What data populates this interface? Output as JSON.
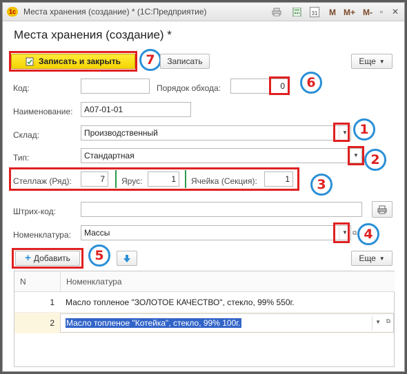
{
  "window": {
    "title": "Места хранения (создание) * (1С:Предприятие)",
    "toolbar_m": "M",
    "toolbar_mplus": "M+",
    "toolbar_mminus": "M-",
    "calendar_day": "31"
  },
  "page": {
    "title": "Места хранения (создание) *"
  },
  "command_bar": {
    "save_close": "Записать и закрыть",
    "save": "Записать",
    "more": "Еще"
  },
  "fields": {
    "code_label": "Код:",
    "code_value": "",
    "order_label": "Порядок обхода:",
    "order_value": "0",
    "name_label": "Наименование:",
    "name_value": "А07-01-01",
    "warehouse_label": "Склад:",
    "warehouse_value": "Производственный",
    "type_label": "Тип:",
    "type_value": "Стандартная",
    "rack_label": "Стеллаж (Ряд):",
    "rack_value": "7",
    "tier_label": "Ярус:",
    "tier_value": "1",
    "cell_label": "Ячейка (Секция):",
    "cell_value": "1",
    "barcode_label": "Штрих-код:",
    "barcode_value": "",
    "nomenclature_label": "Номенклатура:",
    "nomenclature_value": "Массы"
  },
  "table_bar": {
    "add": "Добавить",
    "more": "Еще"
  },
  "table": {
    "headers": [
      "N",
      "Номенклатура"
    ],
    "rows": [
      {
        "n": "1",
        "item": "Масло топленое \"ЗОЛОТОЕ КАЧЕСТВО\", стекло, 99% 550г."
      },
      {
        "n": "2",
        "item": "Масло топленое \"Котейка\", стекло, 99% 100г."
      }
    ]
  },
  "annotations": [
    "1",
    "2",
    "3",
    "4",
    "5",
    "6",
    "7"
  ],
  "colors": {
    "annotation_box": "#e02020",
    "annotation_circle": "#2a8fd6",
    "primary_button": "#f4d400",
    "selected_row": "#fdf6df",
    "selection": "#3264c8"
  }
}
